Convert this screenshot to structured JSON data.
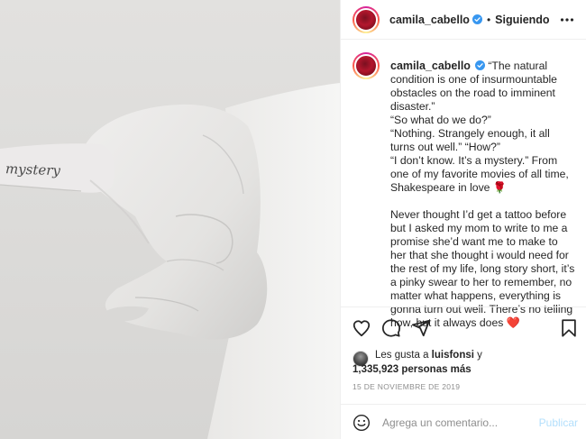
{
  "photo": {
    "tattoo_text": "mystery"
  },
  "header": {
    "username": "camila_cabello",
    "separator": "•",
    "follow_status": "Siguiendo"
  },
  "caption": {
    "username": "camila_cabello",
    "lines": [
      "“The natural condition is one of insurmountable obstacles on the road to imminent disaster.”",
      "“So what do we do?”",
      "“Nothing. Strangely enough, it all turns out well.” “How?”",
      "“I don’t know. It’s a mystery.” From one of my favorite movies of all time, Shakespeare in love 🌹"
    ],
    "paragraph2": "Never thought I’d get a tattoo before but I asked my mom to write to me a promise she’d want me to make to her that she thought i would need for the rest of my life, long story short, it’s a pinky swear to her to remember, no matter what happens, everything is gonna turn out well. There’s no telling how, but it always does ❤️"
  },
  "likes": {
    "prefix": "Les gusta a ",
    "liker": "luisfonsi",
    "conj": " y",
    "count": "1,335,923 personas más"
  },
  "date": "15 de noviembre de 2019",
  "comment": {
    "placeholder": "Agrega un comentario...",
    "publish_label": "Publicar"
  },
  "icons": {
    "verified": "verified-badge-icon",
    "more": "more-options-icon",
    "like": "heart-icon",
    "comment": "comment-icon",
    "share": "share-icon",
    "save": "bookmark-icon",
    "emoji": "emoji-icon"
  },
  "colors": {
    "verified_blue": "#3897f0",
    "link_disabled": "#b2dffc",
    "muted": "#8e8e8e",
    "text": "#262626"
  }
}
